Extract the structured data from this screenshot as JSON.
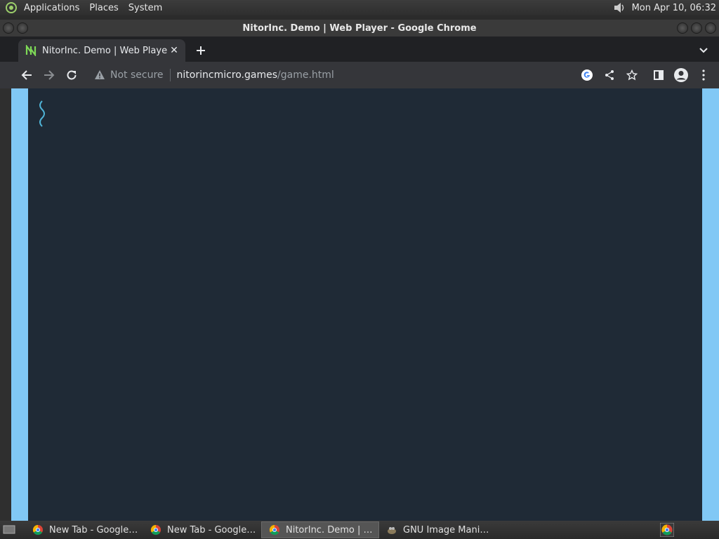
{
  "top_panel": {
    "menus": [
      "Applications",
      "Places",
      "System"
    ],
    "clock": "Mon Apr 10, 06:32"
  },
  "window": {
    "title": "NitorInc. Demo | Web Player - Google Chrome"
  },
  "tab": {
    "title": "NitorInc. Demo | Web Player"
  },
  "omnibox": {
    "security": "Not secure",
    "url_host": "nitorincmicro.games",
    "url_path": "/game.html"
  },
  "taskbar": {
    "tasks": [
      {
        "label": "New Tab - Google C…",
        "icon": "chrome-icon"
      },
      {
        "label": "New Tab - Google C…",
        "icon": "chrome-icon"
      },
      {
        "label": "NitorInc. Demo | We…",
        "icon": "chrome-icon",
        "active": true
      },
      {
        "label": "GNU Image Manipul…",
        "icon": "gimp-icon"
      }
    ]
  },
  "colors": {
    "game_background": "#1f2a36",
    "page_background": "#81c8f5"
  }
}
